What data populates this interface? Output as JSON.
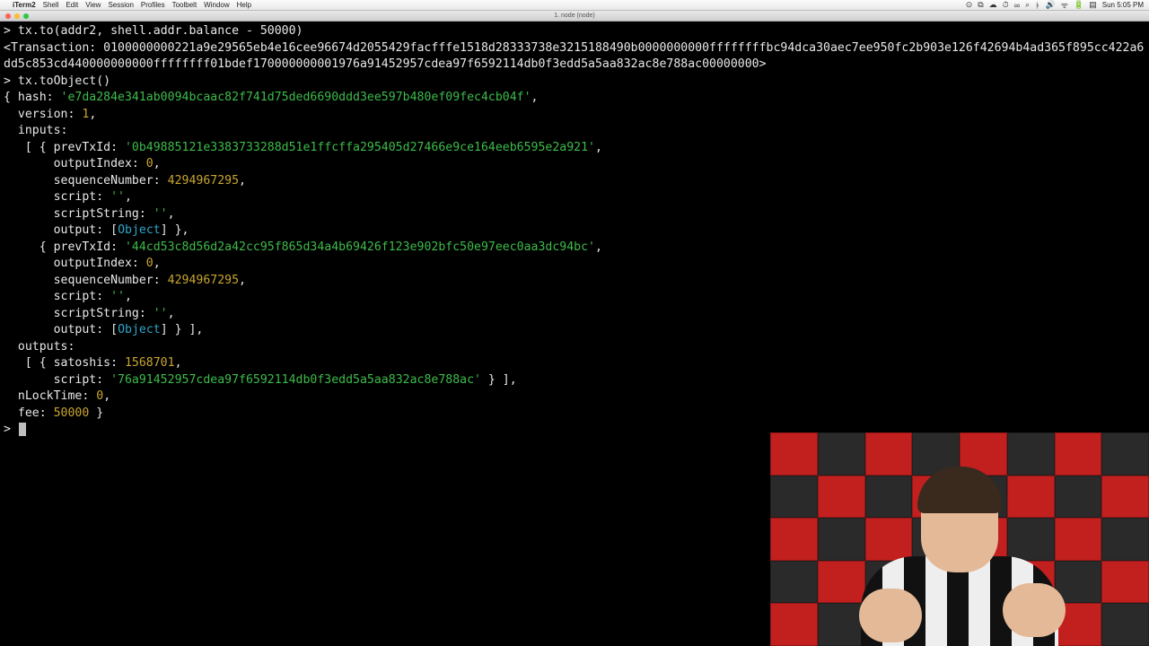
{
  "menubar": {
    "app": "iTerm2",
    "items": [
      "Shell",
      "Edit",
      "View",
      "Session",
      "Profiles",
      "Toolbelt",
      "Window",
      "Help"
    ],
    "clock": "Sun 5:05 PM"
  },
  "titlebar": {
    "title": "1. node (node)"
  },
  "terminal": {
    "prompt": ">",
    "line1_cmd": "tx.to(addr2, shell.addr.balance - 50000)",
    "line2_prefix": "<Transaction: ",
    "line2_hex": "0100000000221a9e29565eb4e16cee96674d2055429facfffe1518d28333738e3215188490b0000000000ffffffffbc94dca30aec7ee950fc2b903e126f42694b4ad365f895cc422a6dd5c853cd440000000000ffffffff01bdef170000000001976a91452957cdea97f6592114db0f3edd5a5aa832ac8e788ac00000000>",
    "line3_cmd": "tx.toObject()",
    "obj_open": "{ hash: ",
    "hash": "'e7da284e341ab0094bcaac82f741d75ded6690ddd3ee597b480ef09fec4cb04f'",
    "version_line": "  version: ",
    "version_val": "1",
    "inputs_label": "  inputs:",
    "inputs_open": "   [ { prevTxId: ",
    "prevtx1": "'0b49885121e3383733288d51e1ffcffa295405d27466e9ce164eeb6595e2a921'",
    "outIdx_lbl": "       outputIndex: ",
    "outIdx_val": "0",
    "seq_lbl": "       sequenceNumber: ",
    "seq_val": "4294967295",
    "script_lbl": "       script: ",
    "script_val": "''",
    "scriptStr_lbl": "       scriptString: ",
    "scriptStr_val": "''",
    "output_lbl": "       output: ",
    "output_val_open": "[",
    "output_val_obj": "Object",
    "output_val_close1": "] },",
    "input2_open": "     { prevTxId: ",
    "prevtx2": "'44cd53c8d56d2a42cc95f865d34a4b69426f123e902bfc50e97eec0aa3dc94bc'",
    "output_val_close2": "] } ],",
    "outputs_label": "  outputs:",
    "outputs_open": "   [ { satoshis: ",
    "satoshis_val": "1568701",
    "out_script_lbl": "       script: ",
    "out_script_val": "'76a91452957cdea97f6592114db0f3edd5a5aa832ac8e788ac'",
    "out_close": " } ],",
    "nlock_lbl": "  nLockTime: ",
    "nlock_val": "0",
    "fee_lbl": "  fee: ",
    "fee_val": "50000",
    "obj_close": " }"
  }
}
